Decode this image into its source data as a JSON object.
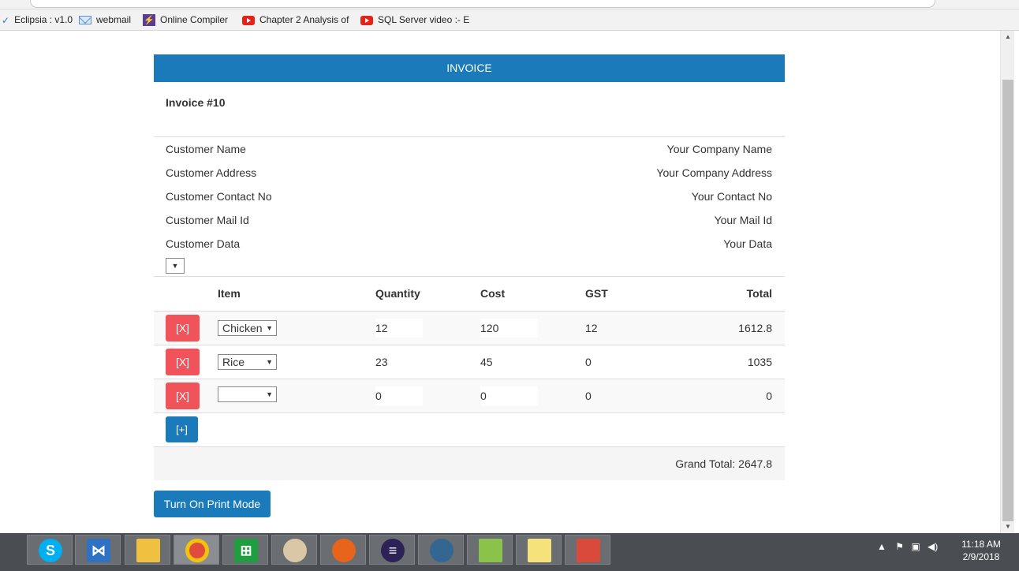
{
  "bookmarks": [
    {
      "label": "Eclipsia : v1.0",
      "icon": "check-icon"
    },
    {
      "label": "webmail",
      "icon": "mail-icon"
    },
    {
      "label": "Online Compiler",
      "icon": "bolt-icon"
    },
    {
      "label": "Chapter 2 Analysis of",
      "icon": "youtube-icon"
    },
    {
      "label": "SQL Server video :- E",
      "icon": "youtube-icon"
    }
  ],
  "invoice": {
    "header": "INVOICE",
    "number": "Invoice #10",
    "customer": {
      "name": "Customer Name",
      "address": "Customer Address",
      "contact": "Customer Contact No",
      "mail": "Customer Mail Id",
      "data": "Customer Data"
    },
    "company": {
      "name": "Your Company Name",
      "address": "Your Company Address",
      "contact": "Your Contact No",
      "mail": "Your Mail Id",
      "data": "Your Data"
    },
    "columns": {
      "item": "Item",
      "quantity": "Quantity",
      "cost": "Cost",
      "gst": "GST",
      "total": "Total"
    },
    "rows": [
      {
        "delete": "[X]",
        "item": "Chicken",
        "quantity": "12",
        "cost": "120",
        "gst": "12",
        "total": "1612.8"
      },
      {
        "delete": "[X]",
        "item": "Rice",
        "quantity": "23",
        "cost": "45",
        "gst": "0",
        "total": "1035"
      },
      {
        "delete": "[X]",
        "item": "",
        "quantity": "0",
        "cost": "0",
        "gst": "0",
        "total": "0"
      }
    ],
    "add_label": "[+]",
    "grand_total": "Grand Total: 2647.8",
    "print_button": "Turn On Print Mode"
  },
  "taskbar": {
    "apps": [
      "skype-icon",
      "visual-studio-icon",
      "file-explorer-icon",
      "chrome-icon",
      "store-icon",
      "paint-icon",
      "firefox-icon",
      "eclipse-icon",
      "postgresql-icon",
      "notepad-plus-icon",
      "sticky-notes-icon",
      "app-icon"
    ],
    "time": "11:18 AM",
    "date": "2/9/2018"
  },
  "colors": {
    "primary": "#1b7ab9",
    "danger": "#f0535a",
    "taskbar": "#4a4d52"
  }
}
